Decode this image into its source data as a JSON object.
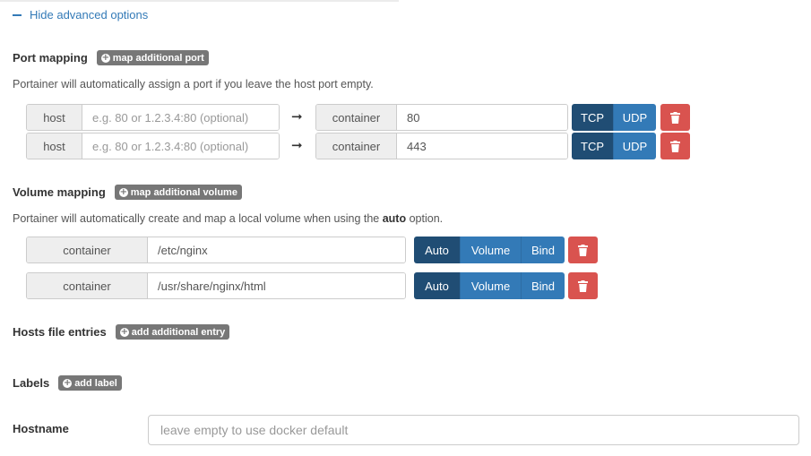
{
  "toggle": {
    "label": "Hide advanced options"
  },
  "port_mapping": {
    "title": "Port mapping",
    "add_label": "map additional port",
    "help": "Portainer will automatically assign a port if you leave the host port empty.",
    "rows": [
      {
        "host_label": "host",
        "host_placeholder": "e.g. 80 or 1.2.3.4:80 (optional)",
        "arrow": "➞",
        "container_label": "container",
        "container_value": "80",
        "protocols": [
          "TCP",
          "UDP"
        ],
        "selected": "TCP"
      },
      {
        "host_label": "host",
        "host_placeholder": "e.g. 80 or 1.2.3.4:80 (optional)",
        "arrow": "➞",
        "container_label": "container",
        "container_value": "443",
        "protocols": [
          "TCP",
          "UDP"
        ],
        "selected": "TCP"
      }
    ]
  },
  "volume_mapping": {
    "title": "Volume mapping",
    "add_label": "map additional volume",
    "help_prefix": "Portainer will automatically create and map a local volume when using the ",
    "help_bold": "auto",
    "help_suffix": " option.",
    "rows": [
      {
        "container_label": "container",
        "container_value": "/etc/nginx",
        "options": [
          "Auto",
          "Volume",
          "Bind"
        ],
        "selected": "Auto"
      },
      {
        "container_label": "container",
        "container_value": "/usr/share/nginx/html",
        "options": [
          "Auto",
          "Volume",
          "Bind"
        ],
        "selected": "Auto"
      }
    ]
  },
  "hosts": {
    "title": "Hosts file entries",
    "add_label": "add additional entry"
  },
  "labels": {
    "title": "Labels",
    "add_label": "add label"
  },
  "hostname": {
    "title": "Hostname",
    "placeholder": "leave empty to use docker default"
  },
  "colors": {
    "primary": "#337ab7",
    "primary_active": "#204d74",
    "danger": "#d9534f",
    "badge": "#777777"
  }
}
